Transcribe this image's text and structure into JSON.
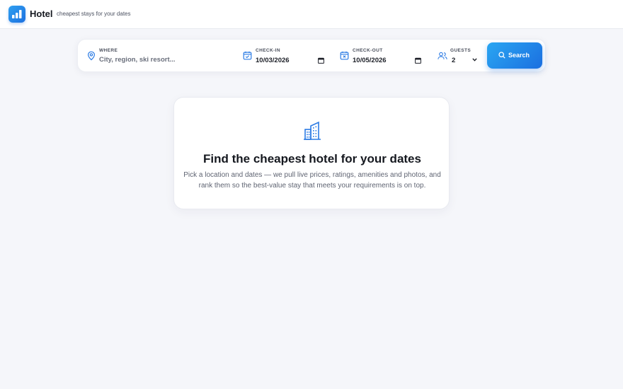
{
  "header": {
    "brand": "Hotel",
    "tagline": "cheapest stays for your dates"
  },
  "search": {
    "where_label": "WHERE",
    "where_placeholder": "City, region, ski resort...",
    "checkin_label": "CHECK-IN",
    "checkin_value": "10/03/2026",
    "checkout_label": "CHECK-OUT",
    "checkout_value": "10/05/2026",
    "guests_label": "GUESTS",
    "guests_value": "2",
    "button_label": "Search"
  },
  "empty_state": {
    "title": "Find the cheapest hotel for your dates",
    "line1": "Pick a location and dates — we pull live prices, ratings, amenities and photos, and",
    "line2": "rank them so the best-value stay that meets your requirements is on top."
  },
  "colors": {
    "accent": "#1f7ee6",
    "background": "#f5f6fa"
  },
  "icons": {
    "logo": "hotel-bars-logo-icon",
    "where": "location-pin-icon",
    "checkin": "calendar-check-icon",
    "checkout": "calendar-x-icon",
    "guests": "users-icon",
    "search": "search-icon",
    "empty": "building-icon"
  }
}
